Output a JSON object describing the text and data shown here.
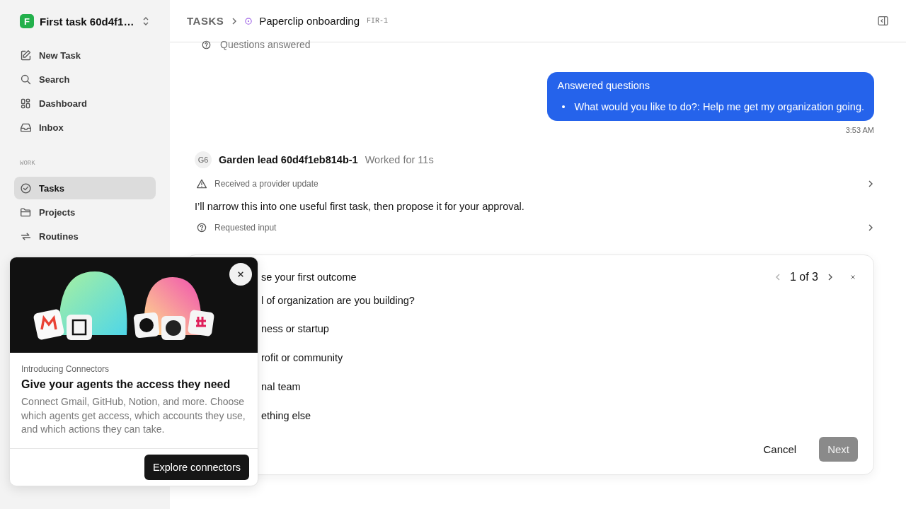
{
  "workspace": {
    "logo_letter": "F",
    "name": "First task 60d4f1…"
  },
  "nav": [
    {
      "label": "New Task",
      "selected": false
    },
    {
      "label": "Search",
      "selected": false
    },
    {
      "label": "Dashboard",
      "selected": false
    },
    {
      "label": "Inbox",
      "selected": false
    }
  ],
  "sections": [
    {
      "title": "WORK",
      "items": [
        {
          "label": "Tasks",
          "selected": true
        },
        {
          "label": "Projects",
          "selected": false
        },
        {
          "label": "Routines",
          "selected": false
        }
      ]
    }
  ],
  "header": {
    "breadcrumb": "TASKS",
    "title": "Paperclip onboarding",
    "task_id": "FIR-1"
  },
  "feed": [
    {
      "kind": "status",
      "text": "Questions answered"
    },
    {
      "kind": "message",
      "title": "Answered questions",
      "marker": "•",
      "bullets": [
        "What would you like to do?: Help me get my organization going."
      ],
      "time": "3:53 AM"
    },
    {
      "kind": "agent",
      "avatar": "G6",
      "name": "Garden lead 60d4f1eb814b-1",
      "meta": "Worked for 11s"
    },
    {
      "kind": "alert",
      "text": "Received a provider update"
    },
    {
      "kind": "text",
      "text": "I’ll narrow this into one useful first task, then propose it for your approval."
    },
    {
      "kind": "request",
      "text": "Requested input"
    }
  ],
  "question_card": {
    "title": "se your first outcome",
    "counter": "1 of 3",
    "question": "l of organization are you building?",
    "options": [
      "ness or startup",
      "rofit or community",
      "nal team",
      "ething else"
    ],
    "buttons": [
      {
        "label": "Cancel",
        "kind": "plain",
        "disabled": false
      },
      {
        "label": "Next",
        "kind": "primary",
        "disabled": true
      }
    ]
  },
  "popup": {
    "eyebrow": "Introducing Connectors",
    "title": "Give your agents the access they need",
    "body": "Connect Gmail, GitHub, Notion, and more. Choose which agents get access, which accounts they use, and which actions they can take.",
    "button": "Explore connectors"
  }
}
